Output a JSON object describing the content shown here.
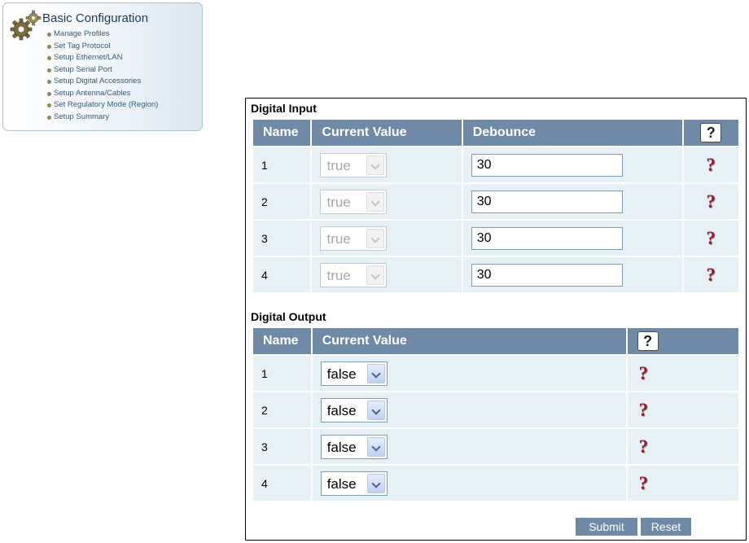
{
  "sidebar": {
    "title": "Basic Configuration",
    "icon": "gears-icon",
    "items": [
      {
        "label": "Manage Profiles"
      },
      {
        "label": "Set Tag Protocol"
      },
      {
        "label": "Setup Ethernet/LAN"
      },
      {
        "label": "Setup Serial Port"
      },
      {
        "label": "Setup Digital Accessories"
      },
      {
        "label": "Setup Antenna/Cables"
      },
      {
        "label": "Set Regulatory Mode (Region)"
      },
      {
        "label": "Setup Summary"
      }
    ]
  },
  "digital_input": {
    "title": "Digital Input",
    "headers": {
      "name": "Name",
      "current_value": "Current Value",
      "debounce": "Debounce",
      "help": "?"
    },
    "rows": [
      {
        "name": "1",
        "current_value": "true",
        "debounce": "30"
      },
      {
        "name": "2",
        "current_value": "true",
        "debounce": "30"
      },
      {
        "name": "3",
        "current_value": "true",
        "debounce": "30"
      },
      {
        "name": "4",
        "current_value": "true",
        "debounce": "30"
      }
    ]
  },
  "digital_output": {
    "title": "Digital Output",
    "headers": {
      "name": "Name",
      "current_value": "Current Value",
      "help": "?"
    },
    "rows": [
      {
        "name": "1",
        "current_value": "false"
      },
      {
        "name": "2",
        "current_value": "false"
      },
      {
        "name": "3",
        "current_value": "false"
      },
      {
        "name": "4",
        "current_value": "false"
      }
    ]
  },
  "help_glyph": "?",
  "buttons": {
    "submit": "Submit",
    "reset": "Reset"
  },
  "colors": {
    "header_bg": "#6f8aa6",
    "row_bg": "#e7f0f5",
    "help_red": "#a5102a",
    "sidebar_text": "#355a7e"
  }
}
